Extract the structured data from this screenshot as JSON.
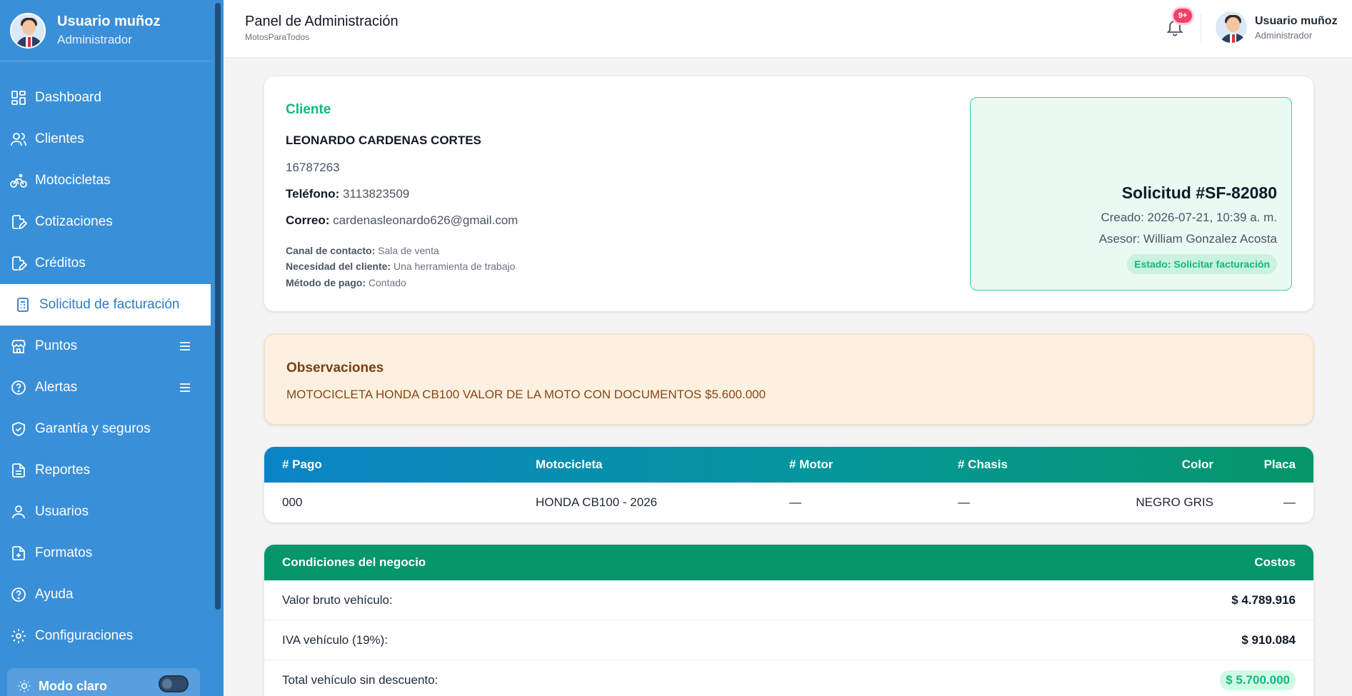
{
  "sidebar": {
    "user_name": "Usuario muñoz",
    "user_role": "Administrador",
    "items": [
      {
        "label": "Dashboard",
        "icon": "dashboard-icon"
      },
      {
        "label": "Clientes",
        "icon": "users-icon"
      },
      {
        "label": "Motocicletas",
        "icon": "bicycle-icon"
      },
      {
        "label": "Cotizaciones",
        "icon": "document-edit-icon"
      },
      {
        "label": "Créditos",
        "icon": "document-edit-icon"
      },
      {
        "label": "Solicitud de facturación",
        "icon": "invoice-icon",
        "active": true
      },
      {
        "label": "Puntos",
        "icon": "store-icon",
        "submenu": true
      },
      {
        "label": "Alertas",
        "icon": "help-circle-icon",
        "submenu": true
      },
      {
        "label": "Garantía y seguros",
        "icon": "shield-icon"
      },
      {
        "label": "Reportes",
        "icon": "report-icon"
      },
      {
        "label": "Usuarios",
        "icon": "user-icon"
      },
      {
        "label": "Formatos",
        "icon": "file-icon"
      },
      {
        "label": "Ayuda",
        "icon": "help-circle-icon"
      },
      {
        "label": "Configuraciones",
        "icon": "gear-icon"
      }
    ],
    "mode_label": "Modo claro",
    "accent": "#3a8fd9"
  },
  "header": {
    "title": "Panel de Administración",
    "subtitle": "MotosParaTodos",
    "notifications_badge": "9+",
    "user_name": "Usuario muñoz",
    "user_role": "Administrador"
  },
  "client": {
    "section_title": "Cliente",
    "name": "LEONARDO CARDENAS CORTES",
    "document": "16787263",
    "phone_label": "Teléfono:",
    "phone": "3113823509",
    "email_label": "Correo:",
    "email": "cardenasleonardo626@gmail.com",
    "channel_label": "Canal de contacto:",
    "channel": "Sala de venta",
    "need_label": "Necesidad del cliente:",
    "need": "Una herramienta de trabajo",
    "payment_label": "Método de pago:",
    "payment": "Contado"
  },
  "request": {
    "title": "Solicitud #SF-82080",
    "created": "Creado: 2026-07-21, 10:39 a. m.",
    "advisor": "Asesor: William Gonzalez Acosta",
    "status": "Estado: Solicitar facturación"
  },
  "observations": {
    "title": "Observaciones",
    "text": "MOTOCICLETA HONDA CB100 VALOR DE LA MOTO CON DOCUMENTOS $5.600.000"
  },
  "vehicle_table": {
    "headers": [
      "# Pago",
      "Motocicleta",
      "# Motor",
      "# Chasis",
      "Color",
      "Placa"
    ],
    "rows": [
      [
        "000",
        "HONDA CB100 - 2026",
        "—",
        "—",
        "NEGRO GRIS",
        "—"
      ]
    ]
  },
  "conditions": {
    "header_left": "Condiciones del negocio",
    "header_right": "Costos",
    "rows": [
      {
        "label": "Valor bruto vehículo:",
        "value": "$ 4.789.916"
      },
      {
        "label": "IVA vehículo (19%):",
        "value": "$ 910.084"
      },
      {
        "label": "Total vehículo sin descuento:",
        "value": "$ 5.700.000"
      }
    ]
  }
}
